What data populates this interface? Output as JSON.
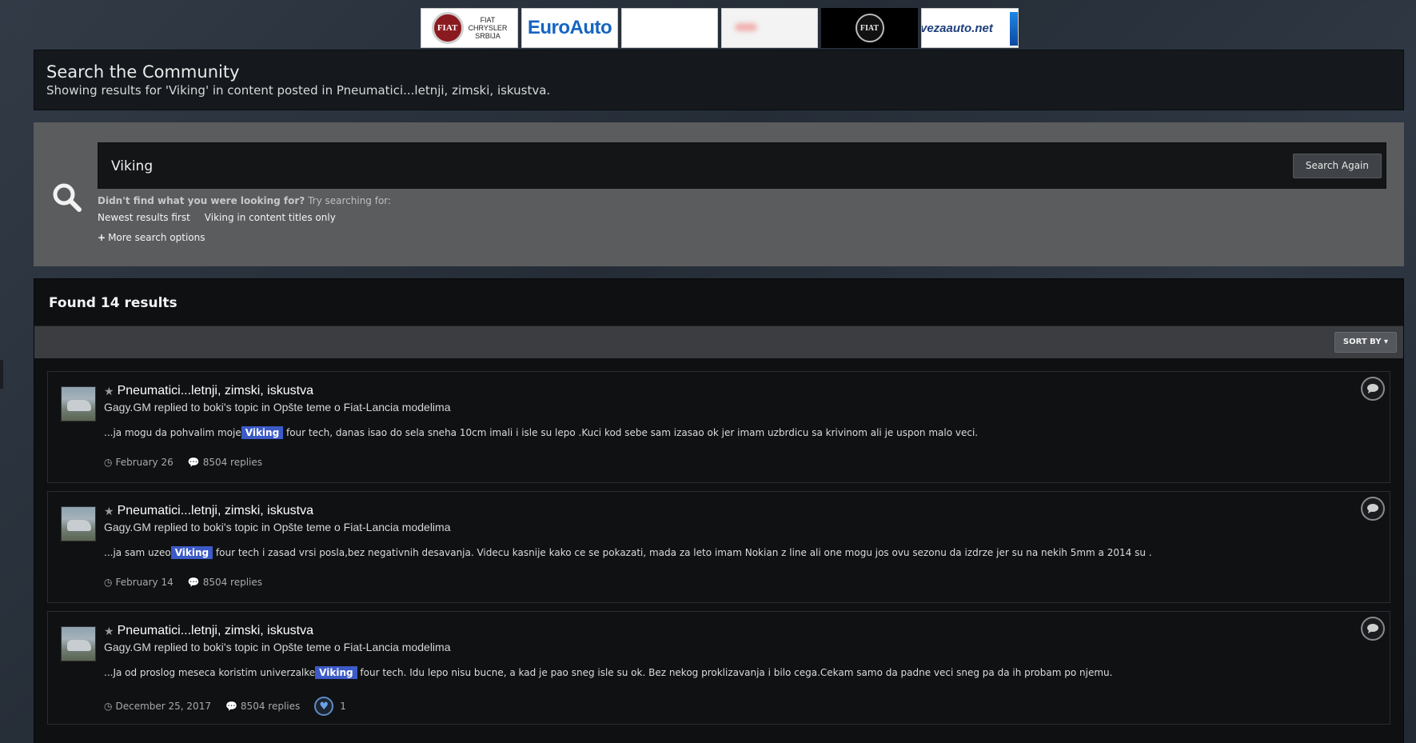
{
  "banners": {
    "b1_logo": "FIAT",
    "b1_text": [
      "FIAT",
      "CHRYSLER",
      "SRBIJA"
    ],
    "b2_text": "EuroAuto",
    "b5_logo": "FIAT",
    "b6_text": "vezaauto.net"
  },
  "header": {
    "title": "Search the Community",
    "description": "Showing results for 'Viking' in content posted in Pneumatici...letnji, zimski, iskustva."
  },
  "search": {
    "query": "Viking",
    "button_label": "Search Again",
    "didnt_find": "Didn't find what you were looking for?",
    "try_text": "Try searching for:",
    "suggestions": [
      "Newest results first",
      "Viking in content titles only"
    ],
    "more_options": "More search options"
  },
  "results": {
    "heading": "Found 14 results",
    "sort_label": "SORT BY",
    "items": [
      {
        "title": "Pneumatici...letnji, zimski, iskustva",
        "meta": "Gagy.GM replied to boki's topic in Opšte teme o Fiat-Lancia modelima",
        "snippet_before": "...ja mogu da pohvalim moje",
        "snippet_highlight": "Viking",
        "snippet_after": " four tech, danas isao do sela sneha 10cm imali i isle su lepo .Kuci kod sebe sam izasao ok jer imam uzbrdicu sa krivinom ali je uspon malo veci.",
        "date": "February 26",
        "replies": "8504 replies"
      },
      {
        "title": "Pneumatici...letnji, zimski, iskustva",
        "meta": "Gagy.GM replied to boki's topic in Opšte teme o Fiat-Lancia modelima",
        "snippet_before": "...ja sam uzeo",
        "snippet_highlight": "Viking",
        "snippet_after": " four tech i zasad vrsi posla,bez negativnih desavanja. Videcu kasnije kako ce se pokazati, mada za leto imam Nokian z line ali one mogu jos ovu sezonu da izdrze jer su na nekih 5mm a 2014 su .",
        "date": "February 14",
        "replies": "8504 replies"
      },
      {
        "title": "Pneumatici...letnji, zimski, iskustva",
        "meta": "Gagy.GM replied to boki's topic in Opšte teme o Fiat-Lancia modelima",
        "snippet_before": "...Ja od proslog meseca koristim univerzalke",
        "snippet_highlight": "Viking",
        "snippet_after": " four tech. Idu lepo nisu bucne, a kad je pao sneg isle su ok. Bez nekog proklizavanja i bilo cega.Cekam samo da padne veci sneg pa da ih probam po njemu.",
        "date": "December 25, 2017",
        "replies": "8504 replies",
        "reaction_count": "1"
      }
    ]
  },
  "icons": {
    "search": "search-icon",
    "star": "star-icon",
    "clock": "clock-icon",
    "comment": "comment-icon",
    "heart": "heart-icon"
  },
  "colors": {
    "highlight": "#3d5bc7",
    "panel": "#15181c",
    "search_panel": "#5b5c5e"
  }
}
